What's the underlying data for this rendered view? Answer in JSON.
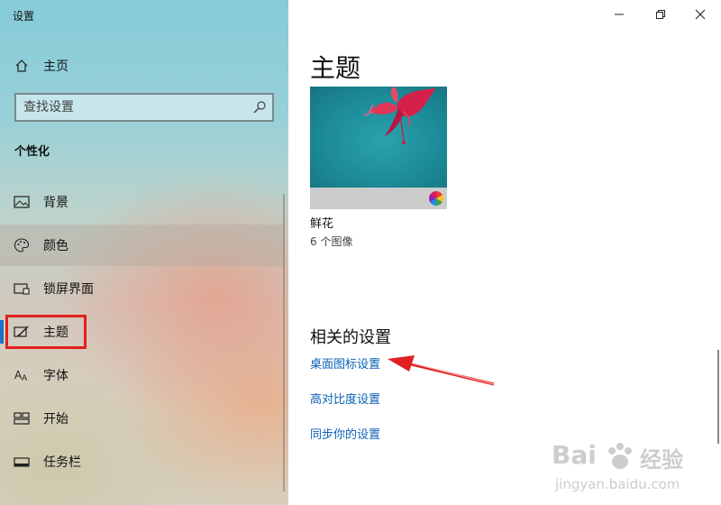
{
  "window": {
    "title": "设置"
  },
  "sidebar": {
    "home": "主页",
    "search_placeholder": "查找设置",
    "section": "个性化",
    "items": [
      {
        "label": "背景",
        "icon": "image-icon"
      },
      {
        "label": "颜色",
        "icon": "palette-icon"
      },
      {
        "label": "锁屏界面",
        "icon": "lockscreen-icon"
      },
      {
        "label": "主题",
        "icon": "theme-icon"
      },
      {
        "label": "字体",
        "icon": "font-icon"
      },
      {
        "label": "开始",
        "icon": "start-icon"
      },
      {
        "label": "任务栏",
        "icon": "taskbar-icon"
      }
    ]
  },
  "main": {
    "title": "主题",
    "theme": {
      "name": "鲜花",
      "count": "6 个图像"
    },
    "related_title": "相关的设置",
    "links": [
      "桌面图标设置",
      "高对比度设置",
      "同步你的设置"
    ]
  },
  "watermark": {
    "brand": "Bai",
    "brand2": "经验",
    "url": "jingyan.baidu.com"
  },
  "colors": {
    "accent": "#0a62b7",
    "highlight": "#e02020",
    "selected_bar": "#1a73c9"
  }
}
